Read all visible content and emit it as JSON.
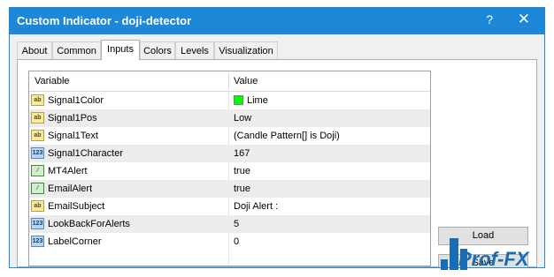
{
  "window": {
    "title": "Custom Indicator - doji-detector",
    "help": "?",
    "close": "✕"
  },
  "tabs": [
    "About",
    "Common",
    "Inputs",
    "Colors",
    "Levels",
    "Visualization"
  ],
  "grid": {
    "col_variable": "Variable",
    "col_value": "Value",
    "rows": [
      {
        "icon": "color-icon",
        "name": "Signal1Color",
        "value": "Lime"
      },
      {
        "icon": "ab-icon",
        "name": "Signal1Pos",
        "value": "Low"
      },
      {
        "icon": "ab-icon",
        "name": "Signal1Text",
        "value": "(Candle Pattern[] is Doji)"
      },
      {
        "icon": "number-icon",
        "name": "Signal1Character",
        "value": "167"
      },
      {
        "icon": "boolean-icon",
        "name": "MT4Alert",
        "value": "true"
      },
      {
        "icon": "boolean-icon",
        "name": "EmailAlert",
        "value": "true"
      },
      {
        "icon": "ab-icon",
        "name": "EmailSubject",
        "value": "Doji Alert :"
      },
      {
        "icon": "number-icon",
        "name": "LookBackForAlerts",
        "value": "5"
      },
      {
        "icon": "number-icon",
        "name": "LabelCorner",
        "value": "0"
      }
    ]
  },
  "buttons": {
    "load": "Load",
    "save": "Save"
  },
  "watermark": {
    "text": "Prof-FX"
  },
  "colors": {
    "accent": "#1e88d8",
    "lime": "#00ff00"
  }
}
